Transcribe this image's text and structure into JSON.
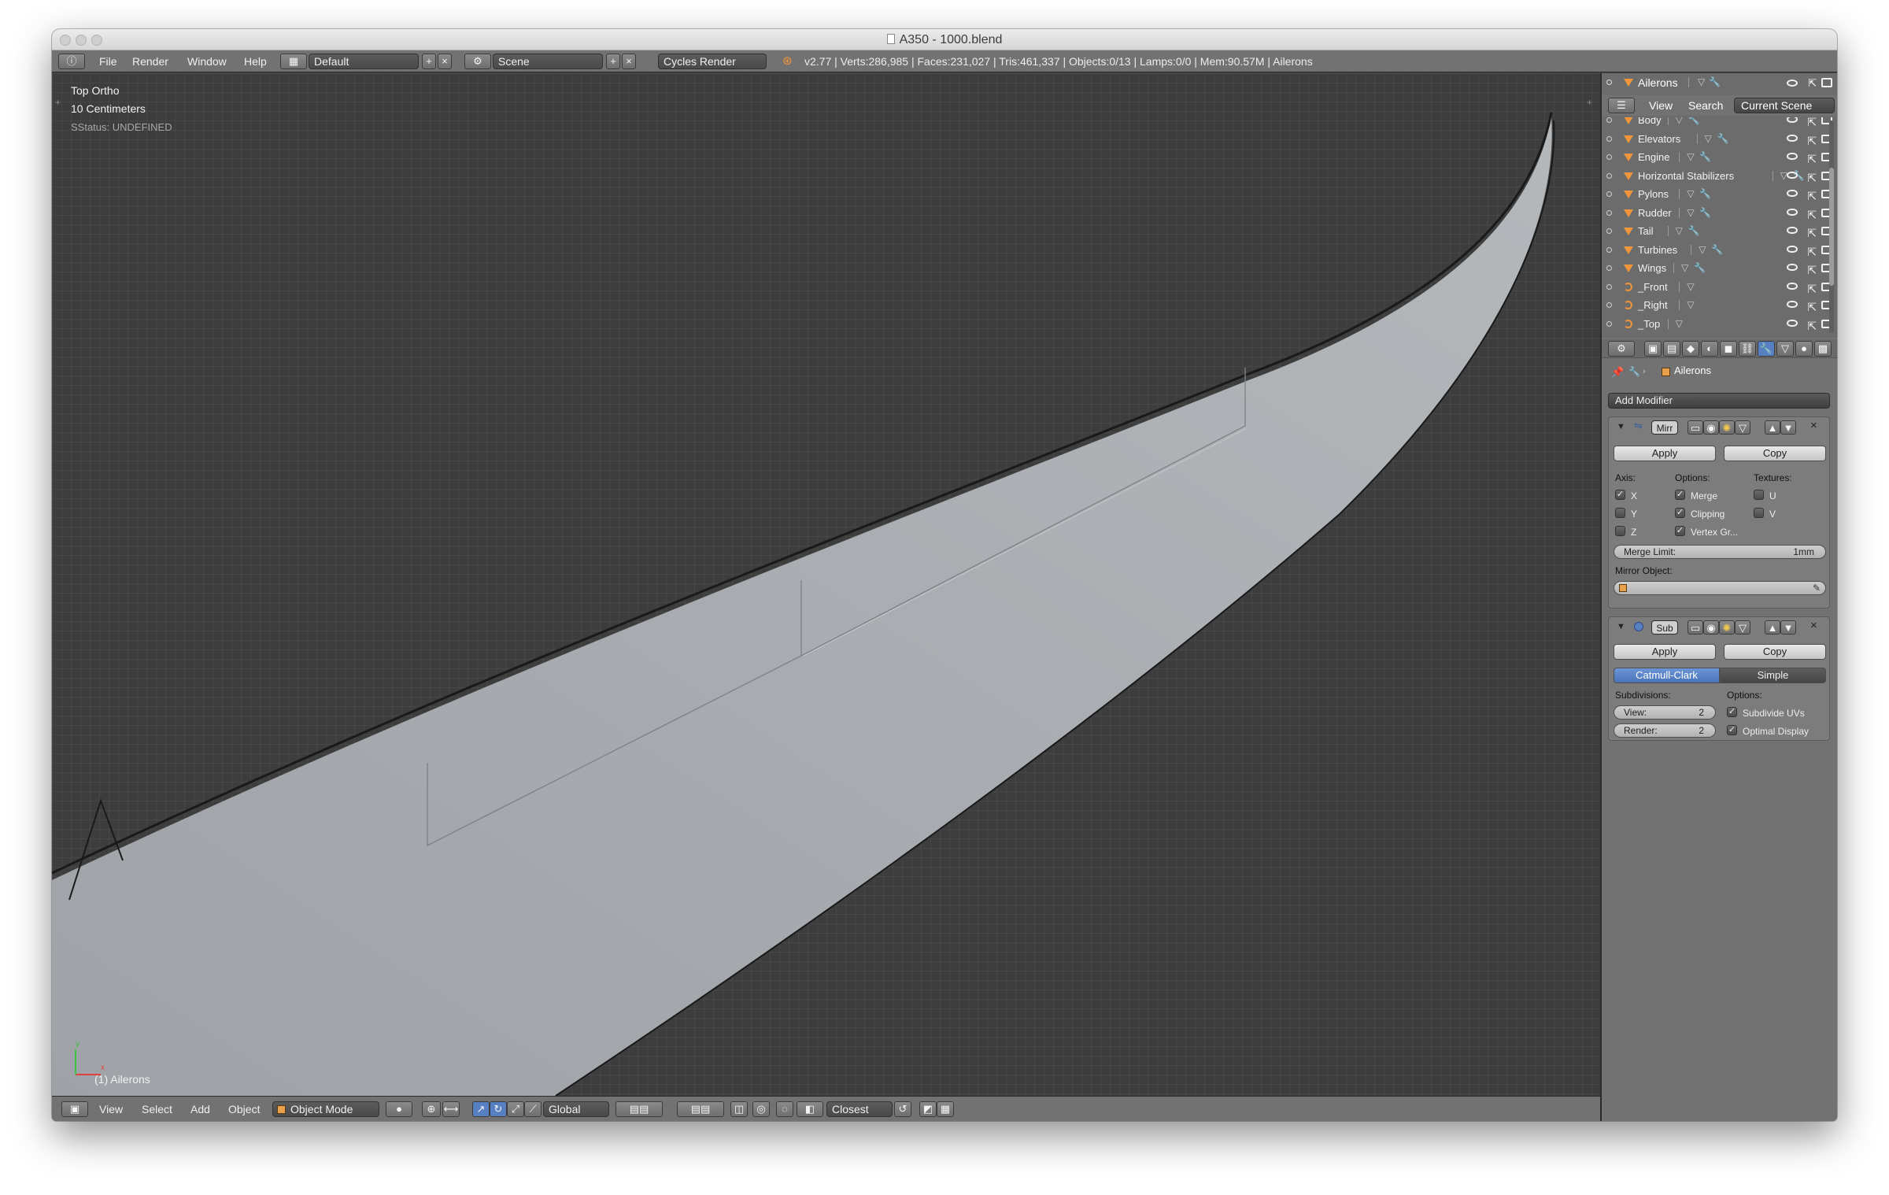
{
  "window": {
    "title": "A350 - 1000.blend"
  },
  "info_header": {
    "menus": [
      "File",
      "Render",
      "Window",
      "Help"
    ],
    "layout": "Default",
    "scene": "Scene",
    "engine": "Cycles Render",
    "stats": "v2.77 | Verts:286,985 | Faces:231,027 | Tris:461,337 | Objects:0/13 | Lamps:0/0 | Mem:90.57M | Ailerons"
  },
  "viewport": {
    "view_name": "Top Ortho",
    "scale": "10 Centimeters",
    "status": "SStatus: UNDEFINED",
    "selected_object": "(1) Ailerons",
    "axis_x": "x",
    "axis_y": "y"
  },
  "footer": {
    "menus": [
      "View",
      "Select",
      "Add",
      "Object"
    ],
    "mode": "Object Mode",
    "orientation": "Global",
    "snap_target": "Closest"
  },
  "outliner": {
    "active": "Ailerons",
    "tabs": [
      "View",
      "Search",
      "Current Scene"
    ],
    "items": [
      {
        "name": "Body",
        "type": "mesh"
      },
      {
        "name": "Elevators",
        "type": "mesh"
      },
      {
        "name": "Engine",
        "type": "mesh"
      },
      {
        "name": "Horizontal Stabilizers",
        "type": "mesh"
      },
      {
        "name": "Pylons",
        "type": "mesh"
      },
      {
        "name": "Rudder",
        "type": "mesh"
      },
      {
        "name": "Tail",
        "type": "mesh"
      },
      {
        "name": "Turbines",
        "type": "mesh"
      },
      {
        "name": "Wings",
        "type": "mesh"
      },
      {
        "name": "_Front",
        "type": "camera"
      },
      {
        "name": "_Right",
        "type": "camera"
      },
      {
        "name": "_Top",
        "type": "camera"
      }
    ]
  },
  "properties": {
    "breadcrumb": "Ailerons",
    "add_modifier": "Add Modifier",
    "mirror": {
      "name": "Mirr",
      "apply": "Apply",
      "copy": "Copy",
      "axis_label": "Axis:",
      "options_label": "Options:",
      "textures_label": "Textures:",
      "axes": [
        {
          "label": "X",
          "checked": true
        },
        {
          "label": "Y",
          "checked": false
        },
        {
          "label": "Z",
          "checked": false
        }
      ],
      "options": [
        {
          "label": "Merge",
          "checked": true
        },
        {
          "label": "Clipping",
          "checked": true
        },
        {
          "label": "Vertex Gr...",
          "checked": true
        }
      ],
      "textures": [
        {
          "label": "U",
          "checked": false
        },
        {
          "label": "V",
          "checked": false
        }
      ],
      "merge_limit_label": "Merge Limit:",
      "merge_limit_value": "1mm",
      "mirror_object_label": "Mirror Object:"
    },
    "subsurf": {
      "name": "Sub",
      "apply": "Apply",
      "copy": "Copy",
      "catmull": "Catmull-Clark",
      "simple": "Simple",
      "subdivisions_label": "Subdivisions:",
      "options_label": "Options:",
      "view_label": "View:",
      "view_value": "2",
      "render_label": "Render:",
      "render_value": "2",
      "subdivide_uvs": "Subdivide UVs",
      "optimal_display": "Optimal Display"
    }
  },
  "colors": {
    "accent": "#5680c2",
    "orange": "#f1953c",
    "viewport_bg": "#3d3d3d"
  }
}
